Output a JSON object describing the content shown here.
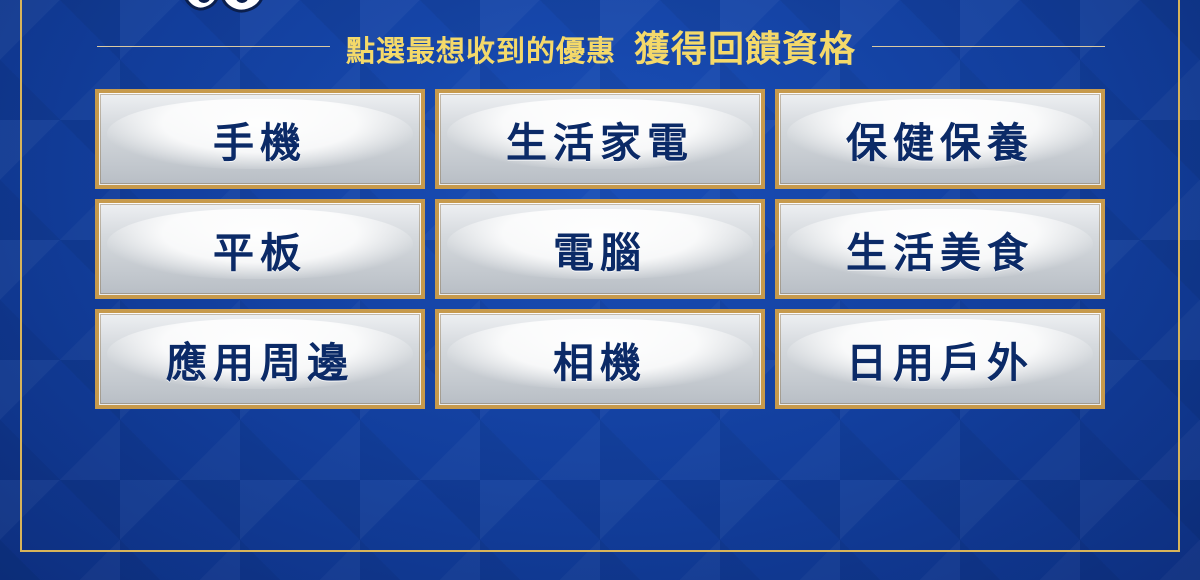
{
  "colors": {
    "background": "#123e9c",
    "gold": "#d8b45a",
    "heading": "#f4d96a",
    "button_text": "#0b2a67"
  },
  "header": {
    "mascot_icon": "mascot-fragment-icon",
    "instruction_text": "點選最想收到的優惠",
    "emphasis_text": "獲得回饋資格"
  },
  "categories": [
    {
      "label": "手機"
    },
    {
      "label": "生活家電"
    },
    {
      "label": "保健保養"
    },
    {
      "label": "平板"
    },
    {
      "label": "電腦"
    },
    {
      "label": "生活美食"
    },
    {
      "label": "應用周邊"
    },
    {
      "label": "相機"
    },
    {
      "label": "日用戶外"
    }
  ]
}
